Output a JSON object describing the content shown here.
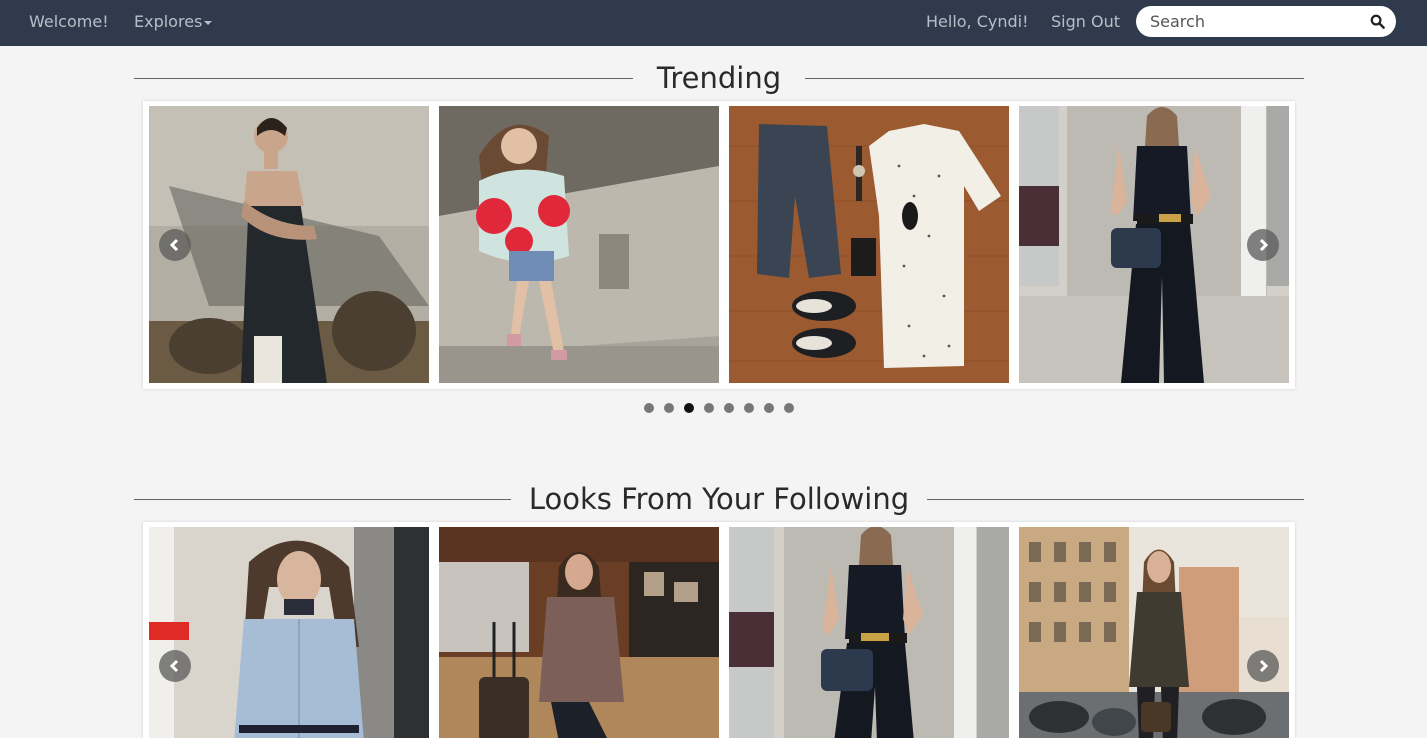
{
  "nav": {
    "welcome": "Welcome!",
    "explores": "Explores",
    "greeting": "Hello, Cyndi!",
    "sign_out": "Sign Out",
    "search_placeholder": "Search"
  },
  "trending": {
    "title": "Trending",
    "slides": [
      {
        "icon": "photo-woman-black-dress"
      },
      {
        "icon": "photo-woman-fluffy-sweater"
      },
      {
        "icon": "photo-flat-lay-outfit"
      },
      {
        "icon": "photo-woman-black-outfit"
      }
    ],
    "pagination": {
      "count": 8,
      "active_index": 2
    }
  },
  "following": {
    "title": "Looks From Your Following",
    "slides": [
      {
        "icon": "photo-woman-blue-shirt"
      },
      {
        "icon": "photo-woman-in-cafe"
      },
      {
        "icon": "photo-woman-black-outfit"
      },
      {
        "icon": "photo-woman-street-scooters"
      }
    ]
  },
  "colors": {
    "navbar": "#2f3b4c",
    "nav_text": "#b7bec8",
    "background": "#f4f4f4"
  }
}
